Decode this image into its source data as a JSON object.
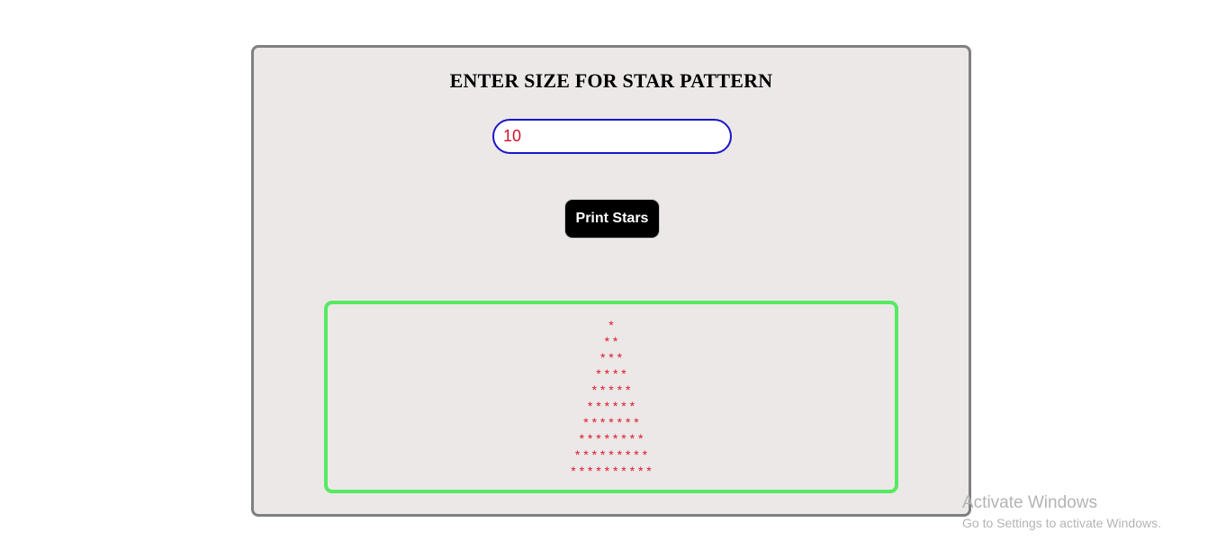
{
  "form": {
    "title": "ENTER SIZE FOR STAR PATTERN",
    "size_value": "10",
    "button_label": "Print Stars"
  },
  "output": {
    "rows": [
      "*",
      "* *",
      "* * *",
      "* * * *",
      "* * * * *",
      "* * * * * *",
      "* * * * * * *",
      "* * * * * * * *",
      "* * * * * * * * *",
      "* * * * * * * * * *"
    ],
    "star_color": "#e0162a"
  },
  "watermark": {
    "title": "Activate Windows",
    "subtitle": "Go to Settings to activate Windows."
  },
  "colors": {
    "card_background": "#ece8e8",
    "card_border": "#808080",
    "input_border": "#1a15c9",
    "input_text": "#d0122a",
    "button_background": "#000000",
    "output_border": "#55ea62"
  }
}
